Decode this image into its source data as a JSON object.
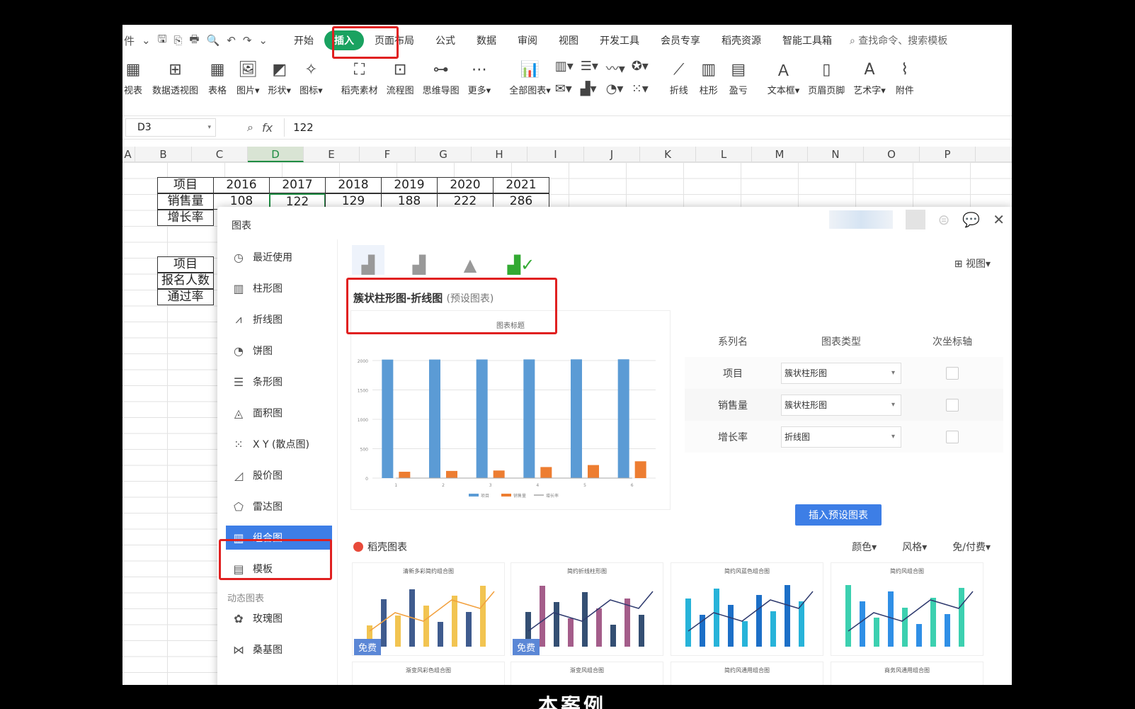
{
  "quick_access": [
    "件",
    "⌄",
    "🖫",
    "⎘",
    "🖶",
    "🔍",
    "↶",
    "↷",
    "⌄"
  ],
  "tabs": [
    "开始",
    "插入",
    "页面布局",
    "公式",
    "数据",
    "审阅",
    "视图",
    "开发工具",
    "会员专享",
    "稻壳资源",
    "智能工具箱"
  ],
  "active_tab": "插入",
  "search_placeholder": "查找命令、搜索模板",
  "tools": [
    {
      "label": "视表",
      "icon": "pivot-chart-icon"
    },
    {
      "label": "数据透视图",
      "icon": "pivot-icon"
    },
    {
      "label": "表格",
      "icon": "table-icon"
    },
    {
      "label": "图片▾",
      "icon": "picture-icon"
    },
    {
      "label": "形状▾",
      "icon": "shape-icon"
    },
    {
      "label": "图标▾",
      "icon": "icon-icon"
    },
    {
      "label": "稻壳素材",
      "icon": "material-icon"
    },
    {
      "label": "流程图",
      "icon": "flowchart-icon"
    },
    {
      "label": "思维导图",
      "icon": "mindmap-icon"
    },
    {
      "label": "更多▾",
      "icon": "more-icon"
    },
    {
      "label": "全部图表▾",
      "icon": "all-charts-icon"
    }
  ],
  "tools_right": [
    {
      "label": "折线",
      "icon": "sparkline-line-icon"
    },
    {
      "label": "柱形",
      "icon": "sparkline-column-icon"
    },
    {
      "label": "盈亏",
      "icon": "sparkline-winloss-icon"
    },
    {
      "label": "文本框▾",
      "icon": "textbox-icon"
    },
    {
      "label": "页眉页脚",
      "icon": "header-footer-icon"
    },
    {
      "label": "艺术字▾",
      "icon": "wordart-icon"
    },
    {
      "label": "附件",
      "icon": "attachment-icon"
    }
  ],
  "formula": {
    "cell_ref": "D3",
    "value": "122"
  },
  "columns": [
    "A",
    "B",
    "C",
    "D",
    "E",
    "F",
    "G",
    "H",
    "I",
    "J",
    "K",
    "L",
    "M",
    "N",
    "O",
    "P"
  ],
  "selected_column": "D",
  "sheet": {
    "header": [
      "项目",
      "2016",
      "2017",
      "2018",
      "2019",
      "2020",
      "2021"
    ],
    "row2_label": "销售量",
    "row2_values": [
      "108",
      "122",
      "129",
      "188",
      "222",
      "286"
    ],
    "row3_label": "增长率",
    "table2_rows": [
      "项目",
      "报名人数",
      "通过率"
    ]
  },
  "dialog": {
    "title": "图表",
    "view_label": "视图▾",
    "sidebar": [
      {
        "label": "最近使用",
        "icon": "clock-icon"
      },
      {
        "label": "柱形图",
        "icon": "column-chart-icon"
      },
      {
        "label": "折线图",
        "icon": "line-chart-icon"
      },
      {
        "label": "饼图",
        "icon": "pie-chart-icon"
      },
      {
        "label": "条形图",
        "icon": "bar-chart-icon"
      },
      {
        "label": "面积图",
        "icon": "area-chart-icon"
      },
      {
        "label": "X Y (散点图)",
        "icon": "scatter-chart-icon"
      },
      {
        "label": "股价图",
        "icon": "stock-chart-icon"
      },
      {
        "label": "雷达图",
        "icon": "radar-chart-icon"
      },
      {
        "label": "组合图",
        "icon": "combo-chart-icon"
      },
      {
        "label": "模板",
        "icon": "template-icon"
      }
    ],
    "active_side": "组合图",
    "dynamic_section": "动态图表",
    "dynamic_items": [
      {
        "label": "玫瑰图",
        "icon": "rose-chart-icon"
      },
      {
        "label": "桑基图",
        "icon": "sankey-chart-icon"
      }
    ],
    "preview_title": "簇状柱形图-折线图",
    "preview_subtitle": "(预设图表)",
    "series_head": [
      "系列名",
      "图表类型",
      "次坐标轴"
    ],
    "series_rows": [
      {
        "name": "项目",
        "type": "簇状柱形图"
      },
      {
        "name": "销售量",
        "type": "簇状柱形图"
      },
      {
        "name": "增长率",
        "type": "折线图"
      }
    ],
    "insert_button": "插入预设图表",
    "library_title": "稻壳图表",
    "filters": [
      "颜色▾",
      "风格▾",
      "免/付费▾"
    ],
    "thumbnails": [
      {
        "title": "清新多彩简约组合图",
        "free": "免费"
      },
      {
        "title": "简约折线柱形图",
        "free": "免费"
      },
      {
        "title": "简约风蓝色组合图",
        "free": ""
      },
      {
        "title": "简约风组合图",
        "free": ""
      }
    ],
    "thumbnails_row2": [
      "渐变风彩色组合图",
      "渐变风组合图",
      "简约风通用组合图",
      "商务风通用组合图"
    ]
  },
  "chart_data": {
    "type": "bar",
    "title": "图表标题",
    "categories": [
      "1",
      "2",
      "3",
      "4",
      "5",
      "6"
    ],
    "series": [
      {
        "name": "项目",
        "values": [
          2016,
          2017,
          2018,
          2019,
          2020,
          2021
        ],
        "color": "#5b9bd5"
      },
      {
        "name": "销售量",
        "values": [
          108,
          122,
          129,
          188,
          222,
          286
        ],
        "color": "#ed7d31"
      },
      {
        "name": "增长率",
        "values": [
          0,
          0,
          0,
          0,
          0,
          0
        ],
        "color": "#a5a5a5"
      }
    ],
    "y_ticks": [
      "0",
      "500",
      "1000",
      "1500",
      "2000"
    ],
    "ylim": [
      0,
      2000
    ],
    "legend_position": "bottom",
    "grid": true
  },
  "caption": "本案例"
}
